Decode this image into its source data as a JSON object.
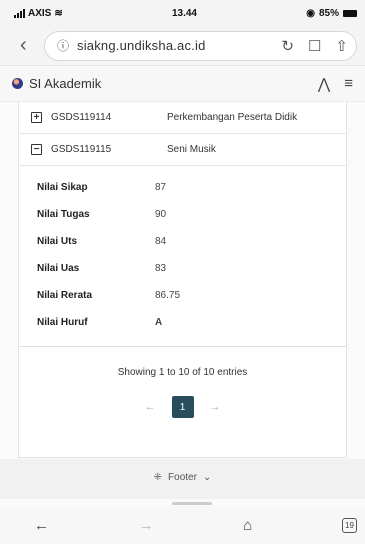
{
  "status": {
    "carrier": "AXIS",
    "time": "13.44",
    "battery": "85%"
  },
  "browser": {
    "url": "siakng.undiksha.ac.id"
  },
  "app": {
    "title": "SI Akademik"
  },
  "courses": [
    {
      "code": "GSDS119114",
      "name": "Perkembangan Peserta Didik",
      "toggle": "+"
    },
    {
      "code": "GSDS119115",
      "name": "Seni Musik",
      "toggle": "−"
    }
  ],
  "grades": [
    {
      "label": "Nilai Sikap",
      "value": "87"
    },
    {
      "label": "Nilai Tugas",
      "value": "90"
    },
    {
      "label": "Nilai Uts",
      "value": "84"
    },
    {
      "label": "Nilai Uas",
      "value": "83"
    },
    {
      "label": "Nilai Rerata",
      "value": "86.75"
    },
    {
      "label": "Nilai Huruf",
      "value": "A"
    }
  ],
  "table_info": "Showing 1 to 10 of 10 entries",
  "pagination": {
    "current": "1"
  },
  "footer_label": "Footer",
  "nav": {
    "tabs_count": "19"
  }
}
